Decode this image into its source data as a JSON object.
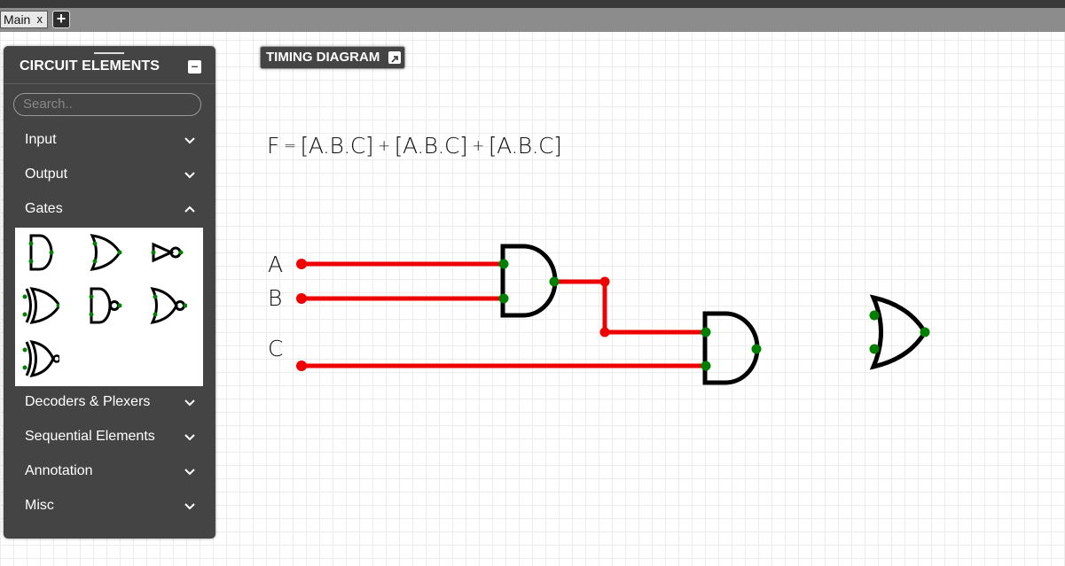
{
  "tabs": [
    {
      "label": "Main",
      "close": "x"
    }
  ],
  "add_tab_label": "+",
  "panel": {
    "title": "CIRCUIT ELEMENTS",
    "minimize_label": "–",
    "search_placeholder": "Search..",
    "categories": [
      {
        "label": "Input",
        "expanded": false
      },
      {
        "label": "Output",
        "expanded": false
      },
      {
        "label": "Gates",
        "expanded": true
      },
      {
        "label": "Decoders & Plexers",
        "expanded": false
      },
      {
        "label": "Sequential Elements",
        "expanded": false
      },
      {
        "label": "Annotation",
        "expanded": false
      },
      {
        "label": "Misc",
        "expanded": false
      }
    ],
    "gate_icons": [
      "and-gate-icon",
      "or-gate-icon",
      "not-gate-icon",
      "xor-gate-icon",
      "nand-gate-icon",
      "nor-gate-icon",
      "xnor-gate-icon"
    ]
  },
  "timing_button": {
    "label": "TIMING DIAGRAM"
  },
  "equation": {
    "lhs": "F",
    "eq": "=",
    "terms": [
      "[A.B.C]",
      "[A.B.C]",
      "[A.B.C]"
    ],
    "op": "+"
  },
  "inputs": [
    "A",
    "B",
    "C"
  ],
  "colors": {
    "wire": "#ee0000",
    "node": "#008000",
    "panel": "#444444",
    "gate": "#000000"
  }
}
